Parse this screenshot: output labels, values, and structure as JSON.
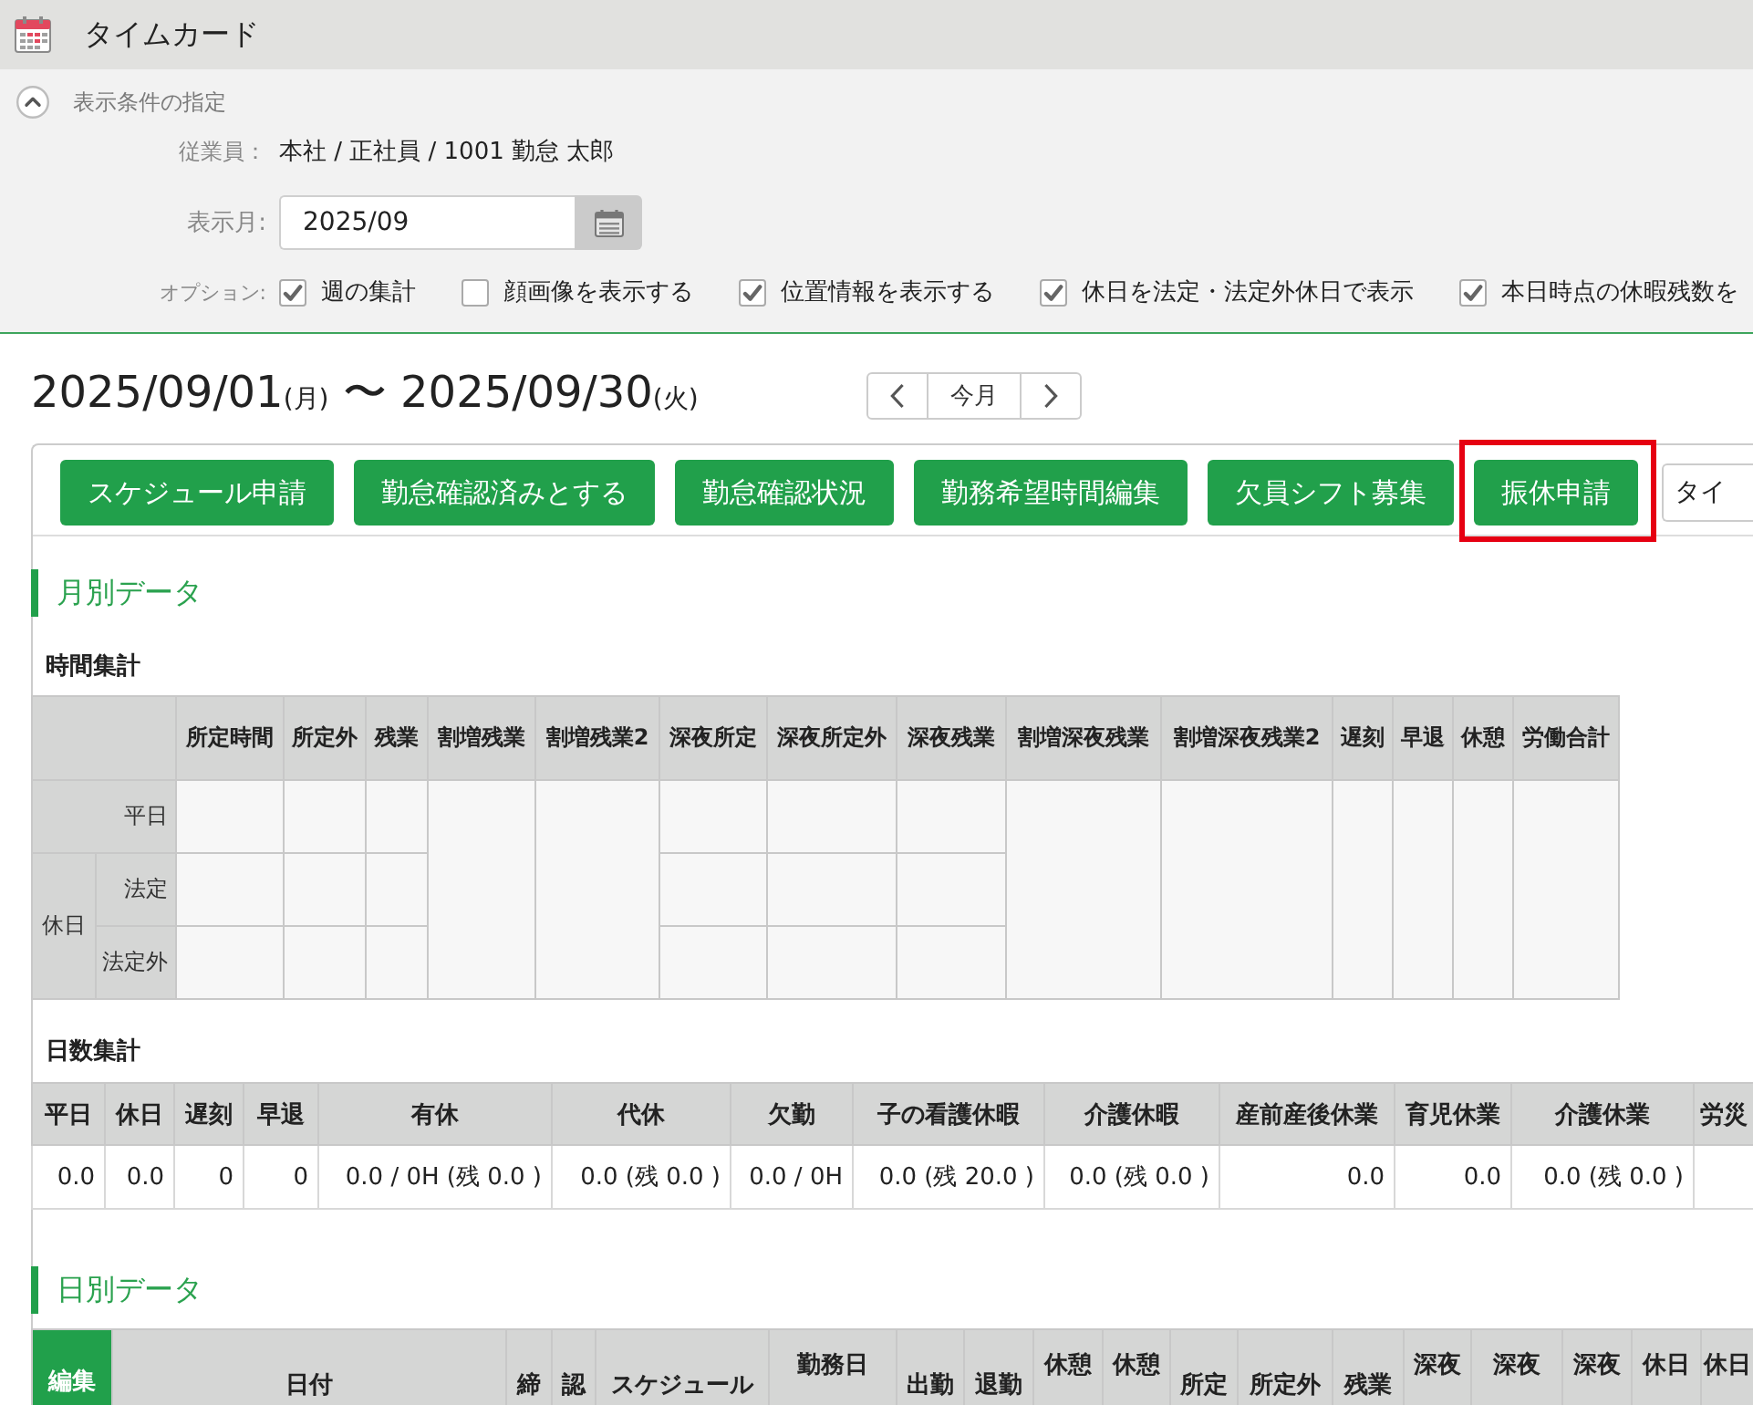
{
  "header": {
    "title": "タイムカード"
  },
  "conditions": {
    "title": "表示条件の指定",
    "expanded": true,
    "employee": {
      "label": "従業員：",
      "value": "本社 / 正社員 / 1001 勤怠 太郎"
    },
    "month": {
      "label": "表示月:",
      "value": "2025/09"
    },
    "options": {
      "label": "オプション:",
      "items": [
        {
          "label": "週の集計",
          "checked": true
        },
        {
          "label": "顔画像を表示する",
          "checked": false
        },
        {
          "label": "位置情報を表示する",
          "checked": true
        },
        {
          "label": "休日を法定・法定外休日で表示",
          "checked": true
        },
        {
          "label": "本日時点の休暇残数を",
          "checked": true
        }
      ]
    }
  },
  "period": {
    "start": "2025/09/01",
    "start_weekday": "(月)",
    "separator": "〜",
    "end": "2025/09/30",
    "end_weekday": "(火)",
    "current_button": "今月"
  },
  "toolbar": {
    "buttons": [
      {
        "label": "スケジュール申請",
        "highlighted": false
      },
      {
        "label": "勤怠確認済みとする",
        "highlighted": false
      },
      {
        "label": "勤怠確認状況",
        "highlighted": false
      },
      {
        "label": "勤務希望時間編集",
        "highlighted": false
      },
      {
        "label": "欠員シフト募集",
        "highlighted": false
      },
      {
        "label": "振休申請",
        "highlighted": true
      }
    ],
    "more_button": "タイ"
  },
  "monthly": {
    "title": "月別データ",
    "time_summary": {
      "title": "時間集計",
      "columns": [
        {
          "label": "所定時間",
          "merged": false
        },
        {
          "label": "所定外",
          "merged": false
        },
        {
          "label": "残業",
          "merged": false
        },
        {
          "label": "割増残業",
          "merged": true
        },
        {
          "label": "割増残業2",
          "merged": true
        },
        {
          "label": "深夜所定",
          "merged": false
        },
        {
          "label": "深夜所定外",
          "merged": false
        },
        {
          "label": "深夜残業",
          "merged": false
        },
        {
          "label": "割増深夜残業",
          "merged": true
        },
        {
          "label": "割増深夜残業2",
          "merged": true
        },
        {
          "label": "遅刻",
          "merged": true
        },
        {
          "label": "早退",
          "merged": true
        },
        {
          "label": "休憩",
          "merged": true
        },
        {
          "label": "労働合計",
          "merged": true
        }
      ],
      "rows": [
        {
          "label": "平日"
        },
        {
          "label": "休日",
          "children": [
            {
              "label": "法定"
            },
            {
              "label": "法定外"
            }
          ]
        }
      ]
    },
    "day_summary": {
      "title": "日数集計",
      "columns": [
        "平日",
        "休日",
        "遅刻",
        "早退",
        "有休",
        "代休",
        "欠勤",
        "子の看護休暇",
        "介護休暇",
        "産前産後休業",
        "育児休業",
        "介護休業",
        "労災"
      ],
      "values": [
        "0.0",
        "0.0",
        "0",
        "0",
        "0.0 / 0H (残 0.0 )",
        "0.0 (残 0.0 )",
        "0.0 / 0H",
        "0.0 (残 20.0 )",
        "0.0 (残 0.0 )",
        "0.0",
        "0.0",
        "0.0 (残 0.0 )"
      ]
    }
  },
  "daily": {
    "title": "日別データ",
    "columns": [
      {
        "label": "編集",
        "kind": "action"
      },
      {
        "label": "日付",
        "kind": "plain"
      },
      {
        "label": "締",
        "kind": "plain"
      },
      {
        "label": "認",
        "kind": "plain"
      },
      {
        "label": "スケジュール",
        "kind": "plain"
      },
      {
        "label": "勤務日",
        "kind": "stacked"
      },
      {
        "label": "出勤",
        "kind": "plain"
      },
      {
        "label": "退勤",
        "kind": "plain"
      },
      {
        "label": "休憩",
        "kind": "stacked"
      },
      {
        "label": "休憩",
        "kind": "stacked"
      },
      {
        "label": "所定",
        "kind": "plain"
      },
      {
        "label": "所定外",
        "kind": "plain"
      },
      {
        "label": "残業",
        "kind": "plain"
      },
      {
        "label": "深夜",
        "kind": "stacked"
      },
      {
        "label": "深夜",
        "kind": "stacked"
      },
      {
        "label": "深夜",
        "kind": "stacked"
      },
      {
        "label": "休日",
        "kind": "stacked"
      },
      {
        "label": "休日",
        "kind": "stacked"
      }
    ]
  }
}
